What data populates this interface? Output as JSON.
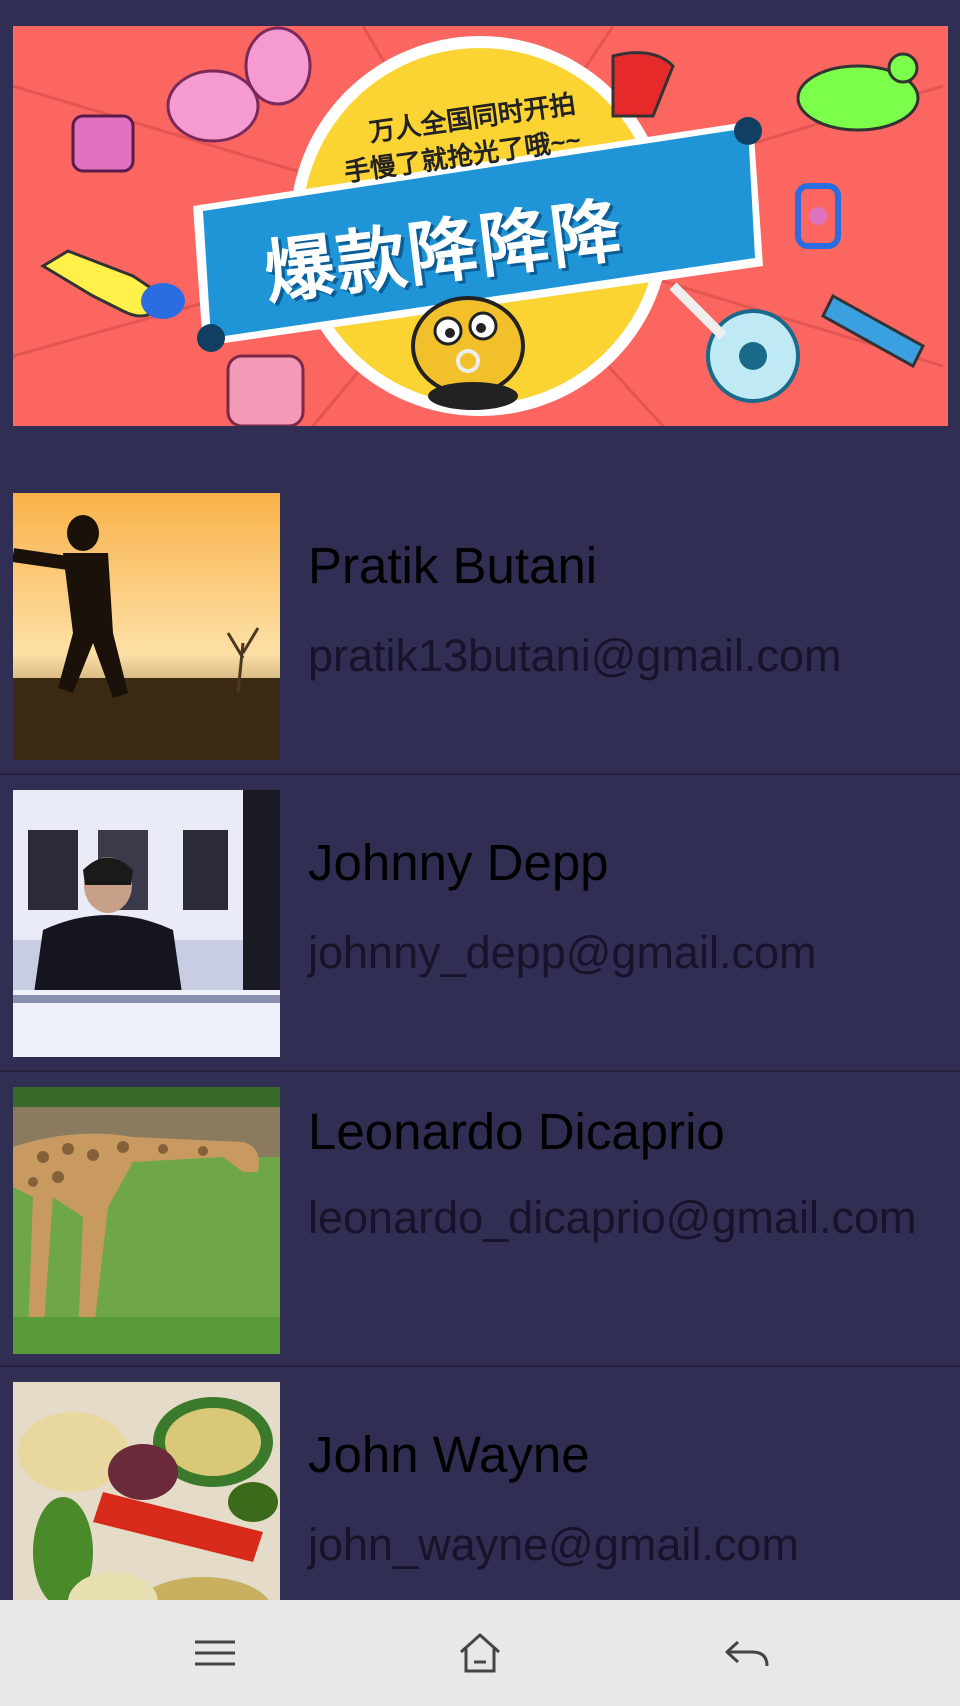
{
  "banner": {
    "line1": "万人全国同时开拍",
    "line2": "手慢了就抢光了哦~~",
    "headline": "爆款降降降"
  },
  "contacts": [
    {
      "name": "Pratik Butani",
      "email": "pratik13butani@gmail.com",
      "thumb": "silhouette-sunset"
    },
    {
      "name": "Johnny Depp",
      "email": "johnny_depp@gmail.com",
      "thumb": "man-at-bar"
    },
    {
      "name": "Leonardo Dicaprio",
      "email": "leonardo_dicaprio@gmail.com",
      "thumb": "giraffe"
    },
    {
      "name": "John Wayne",
      "email": "john_wayne@gmail.com",
      "thumb": "grilled-vegetables"
    }
  ],
  "navbar": {
    "icons": [
      "menu-icon",
      "home-icon",
      "back-icon"
    ]
  },
  "colors": {
    "background": "#302e52",
    "banner": "#fb6661",
    "ribbon": "#1f95d8",
    "navbar": "#e8e8e8"
  }
}
